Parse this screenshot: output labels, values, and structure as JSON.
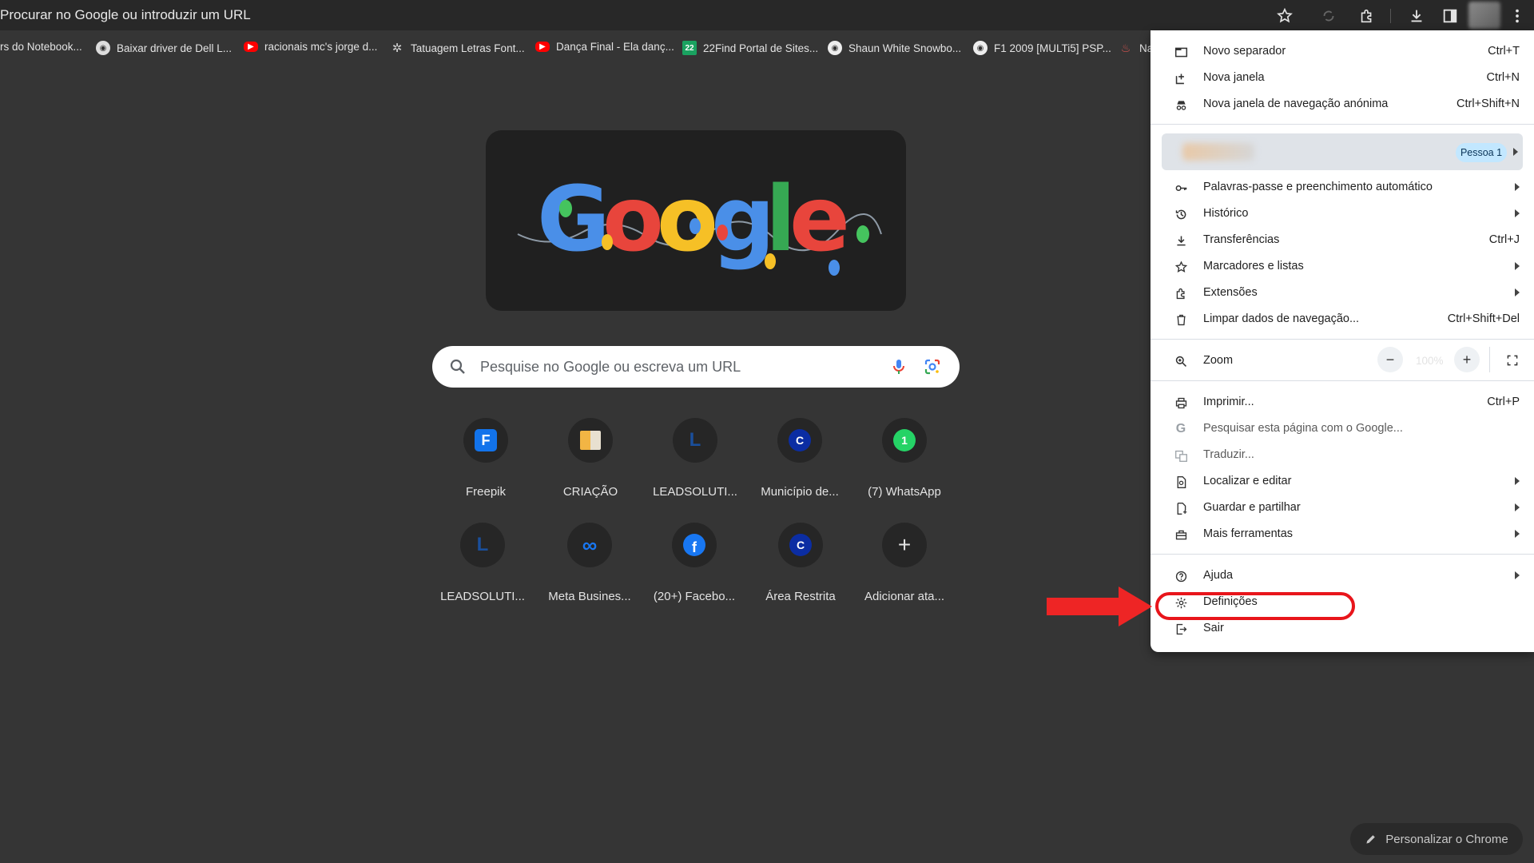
{
  "omnibox": {
    "text": "Procurar no Google ou introduzir um URL"
  },
  "bookmarks": [
    {
      "label": "rs do Notebook...",
      "icon": "none"
    },
    {
      "label": "Baixar driver de Dell L...",
      "icon": "globe-icon"
    },
    {
      "label": "racionais mc's jorge d...",
      "icon": "youtube-icon"
    },
    {
      "label": "Tatuagem Letras Font...",
      "icon": "snowflake-icon"
    },
    {
      "label": "Dança Final - Ela danç...",
      "icon": "youtube-icon"
    },
    {
      "label": "22Find Portal de Sites...",
      "icon": "22find-icon"
    },
    {
      "label": "Shaun White Snowbo...",
      "icon": "globe-icon"
    },
    {
      "label": "F1 2009 [MULTi5] PSP...",
      "icon": "globe-icon"
    },
    {
      "label": "Na",
      "icon": "flame-icon"
    }
  ],
  "search": {
    "placeholder": "Pesquise no Google ou escreva um URL"
  },
  "shortcuts": [
    {
      "label": "Freepik",
      "icon": "freepik-icon"
    },
    {
      "label": "CRIAÇÃO",
      "icon": "book-icon"
    },
    {
      "label": "LEADSOLUTI...",
      "icon": "letter-l-icon"
    },
    {
      "label": "Município de...",
      "icon": "letter-c-icon"
    },
    {
      "label": "(7) WhatsApp",
      "icon": "whatsapp-icon"
    },
    {
      "label": "LEADSOLUTI...",
      "icon": "letter-l-icon"
    },
    {
      "label": "Meta Busines...",
      "icon": "meta-icon"
    },
    {
      "label": "(20+) Facebo...",
      "icon": "facebook-icon"
    },
    {
      "label": "Área Restrita",
      "icon": "letter-c-icon"
    },
    {
      "label": "Adicionar ata...",
      "icon": "plus-icon"
    }
  ],
  "menu": {
    "new_tab": {
      "label": "Novo separador",
      "shortcut": "Ctrl+T"
    },
    "new_window": {
      "label": "Nova janela",
      "shortcut": "Ctrl+N"
    },
    "incognito": {
      "label": "Nova janela de navegação anónima",
      "shortcut": "Ctrl+Shift+N"
    },
    "profile_badge": "Pessoa 1",
    "passwords": {
      "label": "Palavras-passe e preenchimento automático"
    },
    "history": {
      "label": "Histórico"
    },
    "downloads": {
      "label": "Transferências",
      "shortcut": "Ctrl+J"
    },
    "bookmarks": {
      "label": "Marcadores e listas"
    },
    "extensions": {
      "label": "Extensões"
    },
    "clear_data": {
      "label": "Limpar dados de navegação...",
      "shortcut": "Ctrl+Shift+Del"
    },
    "zoom": {
      "label": "Zoom",
      "value": "100%",
      "minus": "−",
      "plus": "+"
    },
    "print": {
      "label": "Imprimir...",
      "shortcut": "Ctrl+P"
    },
    "search_page": {
      "label": "Pesquisar esta página com o Google..."
    },
    "translate": {
      "label": "Traduzir..."
    },
    "find_edit": {
      "label": "Localizar e editar"
    },
    "save_share": {
      "label": "Guardar e partilhar"
    },
    "more_tools": {
      "label": "Mais ferramentas"
    },
    "help": {
      "label": "Ajuda"
    },
    "settings": {
      "label": "Definições"
    },
    "exit": {
      "label": "Sair"
    }
  },
  "customize": {
    "label": "Personalizar o Chrome"
  },
  "colors": {
    "background": "#353535",
    "menu_bg": "#ffffff",
    "annotation_red": "#ee2525",
    "profile_badge_bg": "#c2e7ff"
  }
}
